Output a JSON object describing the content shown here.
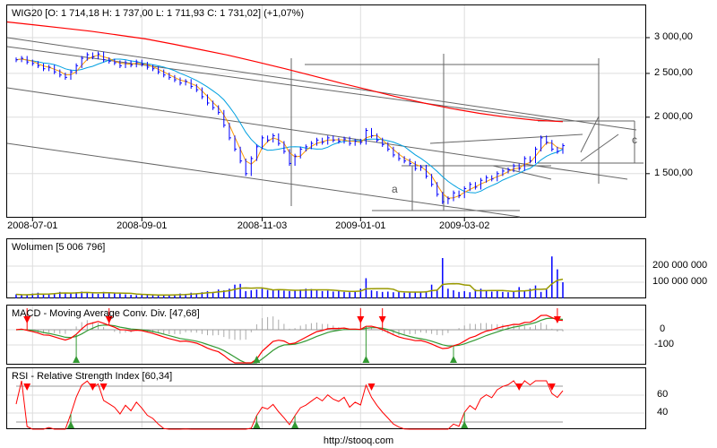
{
  "footer": "http://stooq.com",
  "chart_data": [
    {
      "type": "line",
      "name": "price",
      "title": "WIG20 [O: 1 714,18  H: 1 737,00  L: 1 711,93  C: 1 731,02] (+1,07%)",
      "yscale": "log",
      "ylim": [
        1200,
        3300
      ],
      "yticks": [
        {
          "v": 3000,
          "label": "3 000,00"
        },
        {
          "v": 2500,
          "label": "2 500,00"
        },
        {
          "v": 2000,
          "label": "2 000,00"
        },
        {
          "v": 1500,
          "label": "1 500,00"
        }
      ],
      "xticks": [
        {
          "i": 3,
          "label": "2008-07-01"
        },
        {
          "i": 23,
          "label": "2008-09-01"
        },
        {
          "i": 45,
          "label": "2008-11-03"
        },
        {
          "i": 63,
          "label": "2009-01-01"
        },
        {
          "i": 82,
          "label": "2009-03-02"
        }
      ],
      "closes": [
        2680,
        2700,
        2650,
        2630,
        2600,
        2560,
        2580,
        2520,
        2480,
        2450,
        2520,
        2600,
        2700,
        2750,
        2720,
        2760,
        2680,
        2660,
        2640,
        2600,
        2640,
        2610,
        2650,
        2620,
        2580,
        2560,
        2520,
        2480,
        2450,
        2420,
        2380,
        2400,
        2340,
        2300,
        2220,
        2150,
        2100,
        2050,
        1920,
        1800,
        1700,
        1600,
        1500,
        1620,
        1720,
        1800,
        1780,
        1820,
        1750,
        1680,
        1580,
        1640,
        1700,
        1720,
        1750,
        1780,
        1760,
        1800,
        1780,
        1770,
        1790,
        1750,
        1770,
        1760,
        1870,
        1820,
        1780,
        1740,
        1700,
        1650,
        1620,
        1600,
        1580,
        1540,
        1550,
        1480,
        1420,
        1350,
        1300,
        1320,
        1360,
        1340,
        1390,
        1420,
        1400,
        1450,
        1470,
        1460,
        1500,
        1520,
        1530,
        1560,
        1540,
        1620,
        1600,
        1700,
        1800,
        1760,
        1700,
        1680,
        1730
      ],
      "ma_long": [
        3250,
        3200,
        3150,
        3100,
        3040,
        2980,
        2900,
        2820,
        2740,
        2650,
        2560,
        2470,
        2380,
        2300,
        2220,
        2150,
        2090,
        2040,
        2000,
        1970,
        1955
      ],
      "annotations": [
        "a",
        "c"
      ],
      "series_colors": {
        "bars": "#0000ff",
        "ma_short": "#ff9900",
        "ma_mid": "#00a0e0",
        "ma_long": "#ff0000",
        "trendlines": "#666666"
      }
    },
    {
      "type": "bar",
      "name": "volume",
      "title": "Wolumen [5 006 796]",
      "yticks": [
        {
          "v": 200,
          "label": "200 000 000"
        },
        {
          "v": 100,
          "label": "100 000 000"
        }
      ],
      "unit": "millions",
      "values": [
        25,
        20,
        22,
        30,
        35,
        28,
        30,
        32,
        40,
        35,
        30,
        38,
        42,
        35,
        30,
        28,
        40,
        36,
        32,
        30,
        25,
        22,
        20,
        22,
        24,
        20,
        18,
        20,
        22,
        25,
        30,
        28,
        35,
        30,
        38,
        45,
        40,
        55,
        50,
        60,
        85,
        90,
        45,
        50,
        55,
        60,
        52,
        50,
        55,
        48,
        45,
        50,
        55,
        60,
        58,
        50,
        45,
        48,
        42,
        45,
        40,
        38,
        45,
        60,
        125,
        50,
        45,
        40,
        42,
        38,
        40,
        35,
        38,
        40,
        42,
        45,
        85,
        55,
        250,
        60,
        50,
        40,
        45,
        38,
        55,
        60,
        50,
        42,
        45,
        40,
        38,
        42,
        70,
        45,
        60,
        80,
        40,
        55,
        260,
        180,
        100,
        85,
        60,
        70,
        140,
        60,
        50,
        40,
        30
      ]
    },
    {
      "type": "line",
      "name": "macd",
      "title": "MACD - Moving Average Conv. Div. [47,68]",
      "yticks": [
        {
          "v": 0,
          "label": "0"
        },
        {
          "v": -100,
          "label": "-100"
        }
      ]
    },
    {
      "type": "line",
      "name": "rsi",
      "title": "RSI - Relative Strength Index [60,34]",
      "yticks": [
        {
          "v": 60,
          "label": "60"
        },
        {
          "v": 40,
          "label": "40"
        }
      ],
      "bands": [
        70,
        30
      ]
    }
  ]
}
